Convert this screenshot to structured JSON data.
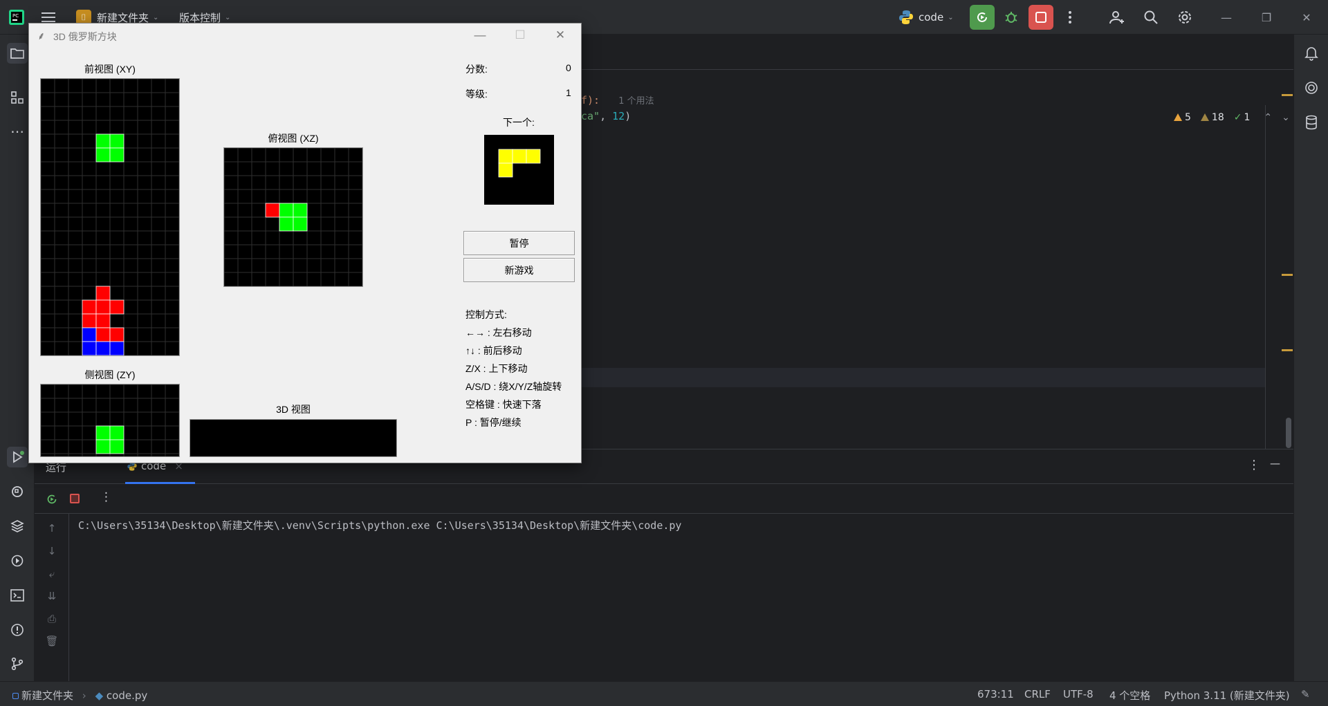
{
  "ide": {
    "project_name": "新建文件夹",
    "vcs_label": "版本控制",
    "run_config": "code",
    "code_visible": {
      "line1_tail": "f):",
      "usage_hint": "1 个用法",
      "line2_str": "ca\"",
      "line2_sep": ", ",
      "line2_num": "12",
      "line2_close": ")"
    },
    "problems": {
      "errors_warn": "5",
      "warnings": "18",
      "ok": "1"
    },
    "colors": {
      "accent": "#3574f0",
      "run_green": "#4f9a4d",
      "stop_red": "#d9534f",
      "warning": "#e8a33d"
    }
  },
  "run_panel": {
    "tab_run": "运行",
    "tab_code": "code",
    "tab_close": "×",
    "console_output": "C:\\Users\\35134\\Desktop\\新建文件夹\\.venv\\Scripts\\python.exe C:\\Users\\35134\\Desktop\\新建文件夹\\code.py"
  },
  "statusbar": {
    "crumb_project": "新建文件夹",
    "crumb_sep": "›",
    "crumb_file": "code.py",
    "position": "673:11",
    "line_sep": "CRLF",
    "encoding": "UTF-8",
    "indent": "4 个空格",
    "interpreter": "Python 3.11 (新建文件夹)"
  },
  "game": {
    "window_title": "3D 俄罗斯方块",
    "front_view_label": "前视图 (XY)",
    "top_view_label": "俯视图 (XZ)",
    "side_view_label": "侧视图 (ZY)",
    "view3d_label": "3D 视图",
    "score_label": "分数:",
    "score_value": "0",
    "level_label": "等级:",
    "level_value": "1",
    "next_label": "下一个:",
    "pause_button": "暂停",
    "new_game_button": "新游戏",
    "controls_title": "控制方式:",
    "controls": [
      "←→ : 左右移动",
      "↑↓ : 前后移动",
      "Z/X : 上下移动",
      "A/S/D : 绕X/Y/Z轴旋转",
      "空格键 : 快速下落",
      "P : 暂停/继续"
    ],
    "colors": {
      "green": "#00ff00",
      "red": "#ff0000",
      "blue": "#0000ff",
      "yellow": "#ffff00"
    },
    "front_view_cells": [
      {
        "c": 4,
        "r": 4,
        "color": "green"
      },
      {
        "c": 5,
        "r": 4,
        "color": "green"
      },
      {
        "c": 4,
        "r": 5,
        "color": "green"
      },
      {
        "c": 5,
        "r": 5,
        "color": "green"
      },
      {
        "c": 4,
        "r": 15,
        "color": "red"
      },
      {
        "c": 3,
        "r": 16,
        "color": "red"
      },
      {
        "c": 4,
        "r": 16,
        "color": "red"
      },
      {
        "c": 5,
        "r": 16,
        "color": "red"
      },
      {
        "c": 3,
        "r": 17,
        "color": "red"
      },
      {
        "c": 4,
        "r": 17,
        "color": "red"
      },
      {
        "c": 3,
        "r": 18,
        "color": "blue"
      },
      {
        "c": 4,
        "r": 18,
        "color": "red"
      },
      {
        "c": 5,
        "r": 18,
        "color": "red"
      },
      {
        "c": 3,
        "r": 19,
        "color": "blue"
      },
      {
        "c": 4,
        "r": 19,
        "color": "blue"
      },
      {
        "c": 5,
        "r": 19,
        "color": "blue"
      }
    ],
    "top_view_cells": [
      {
        "c": 3,
        "r": 4,
        "color": "red"
      },
      {
        "c": 4,
        "r": 4,
        "color": "green"
      },
      {
        "c": 5,
        "r": 4,
        "color": "green"
      },
      {
        "c": 4,
        "r": 5,
        "color": "green"
      },
      {
        "c": 5,
        "r": 5,
        "color": "green"
      }
    ],
    "side_view_cells": [
      {
        "c": 4,
        "r": 3,
        "color": "green"
      },
      {
        "c": 5,
        "r": 3,
        "color": "green"
      },
      {
        "c": 4,
        "r": 4,
        "color": "green"
      },
      {
        "c": 5,
        "r": 4,
        "color": "green"
      }
    ],
    "next_piece_cells": [
      {
        "c": 1,
        "r": 1,
        "color": "yellow"
      },
      {
        "c": 2,
        "r": 1,
        "color": "yellow"
      },
      {
        "c": 3,
        "r": 1,
        "color": "yellow"
      },
      {
        "c": 1,
        "r": 2,
        "color": "yellow"
      }
    ]
  }
}
